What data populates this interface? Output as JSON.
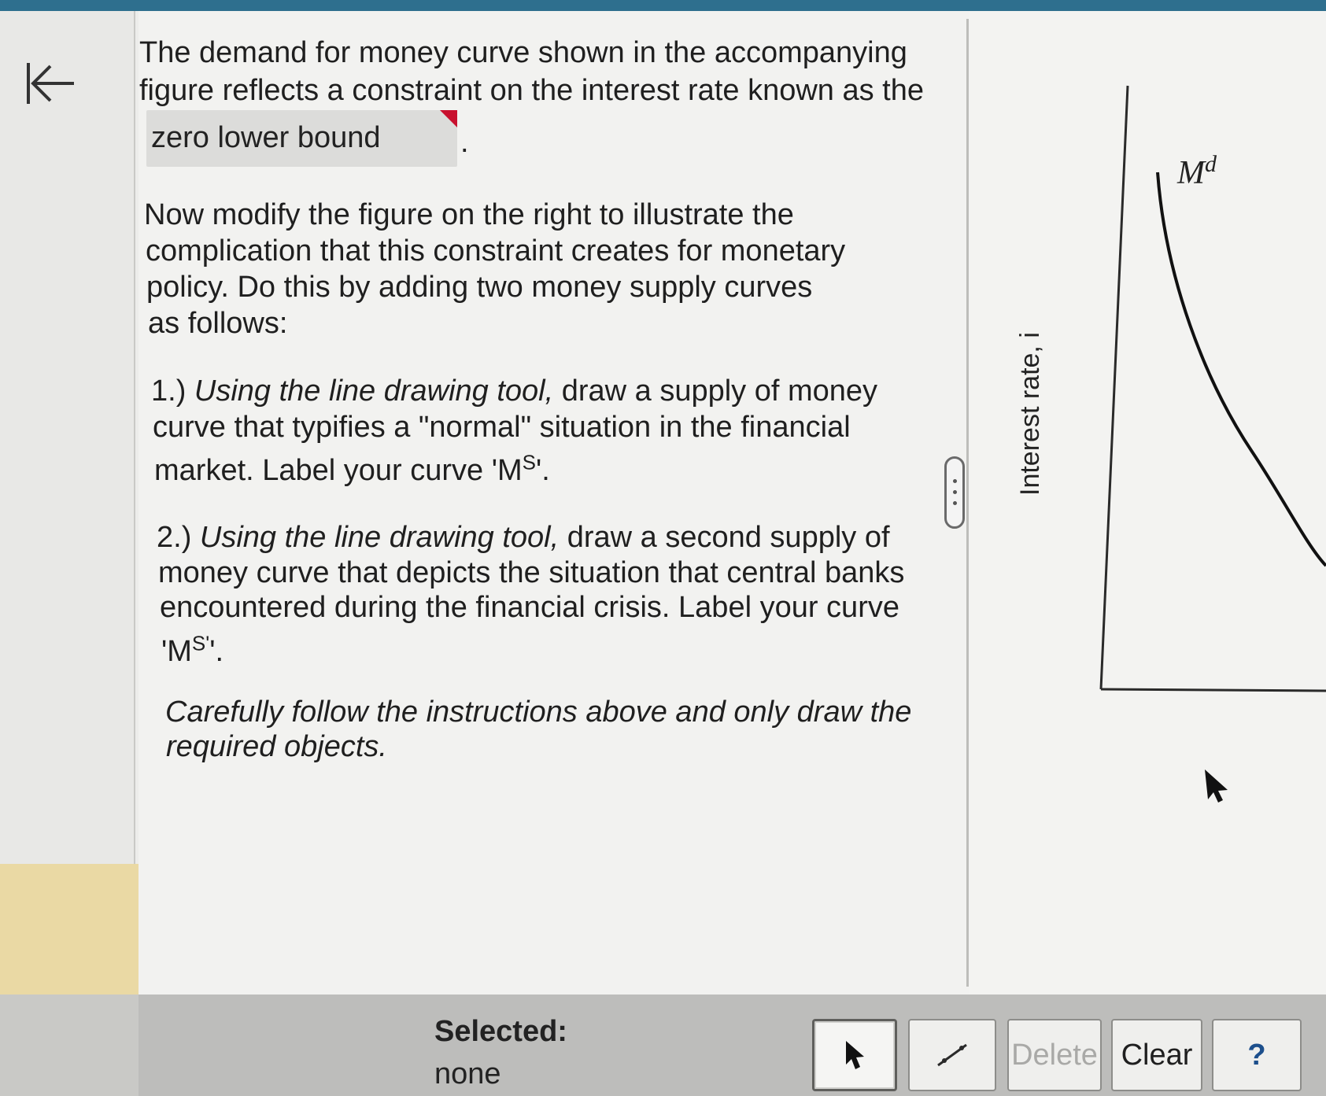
{
  "question": {
    "intro_line1": "The demand for money curve shown in the accompanying",
    "intro_line2": "figure reflects a constraint on the interest rate known as the",
    "answer_value": "zero lower bound",
    "period": ".",
    "modify_line1": "Now modify the figure on the right to illustrate the",
    "modify_line2": "complication that this constraint creates for monetary",
    "modify_line3": "policy. Do this by adding two money supply curves",
    "modify_line4": "as follows:",
    "step1_prefix": "1.) ",
    "step1_tool": "Using the line drawing tool,",
    "step1_line1_rest": " draw a supply of money",
    "step1_line2": "curve that typifies a \"normal\" situation in the financial",
    "step1_line3_a": "market. Label your curve 'M",
    "step1_sup": "S",
    "step1_line3_b": "'.",
    "step2_prefix": "2.) ",
    "step2_tool": "Using the line drawing tool,",
    "step2_line1_rest": " draw a second supply of",
    "step2_line2": "money curve that depicts the situation that central banks",
    "step2_line3": "encountered during the financial crisis. Label your curve",
    "step2_line4_a": "'M",
    "step2_sup": "S'",
    "step2_line4_b": "'.",
    "caution_line1": "Carefully follow the instructions above and only draw the",
    "caution_line2": "required objects."
  },
  "graph": {
    "y_axis_label": "Interest rate, i",
    "curve_label": "M",
    "curve_label_sup": "d"
  },
  "toolbar": {
    "selected_label": "Selected:",
    "selected_value": "none",
    "delete_label": "Delete",
    "clear_label": "Clear",
    "help_label": "?"
  },
  "icons": {
    "back": "first-page-arrow-icon",
    "pointer": "pointer-icon",
    "line": "line-draw-icon"
  },
  "colors": {
    "top_bar": "#2e6f8e",
    "answer_flag": "#c8102e",
    "highlight": "#ead9a4"
  }
}
